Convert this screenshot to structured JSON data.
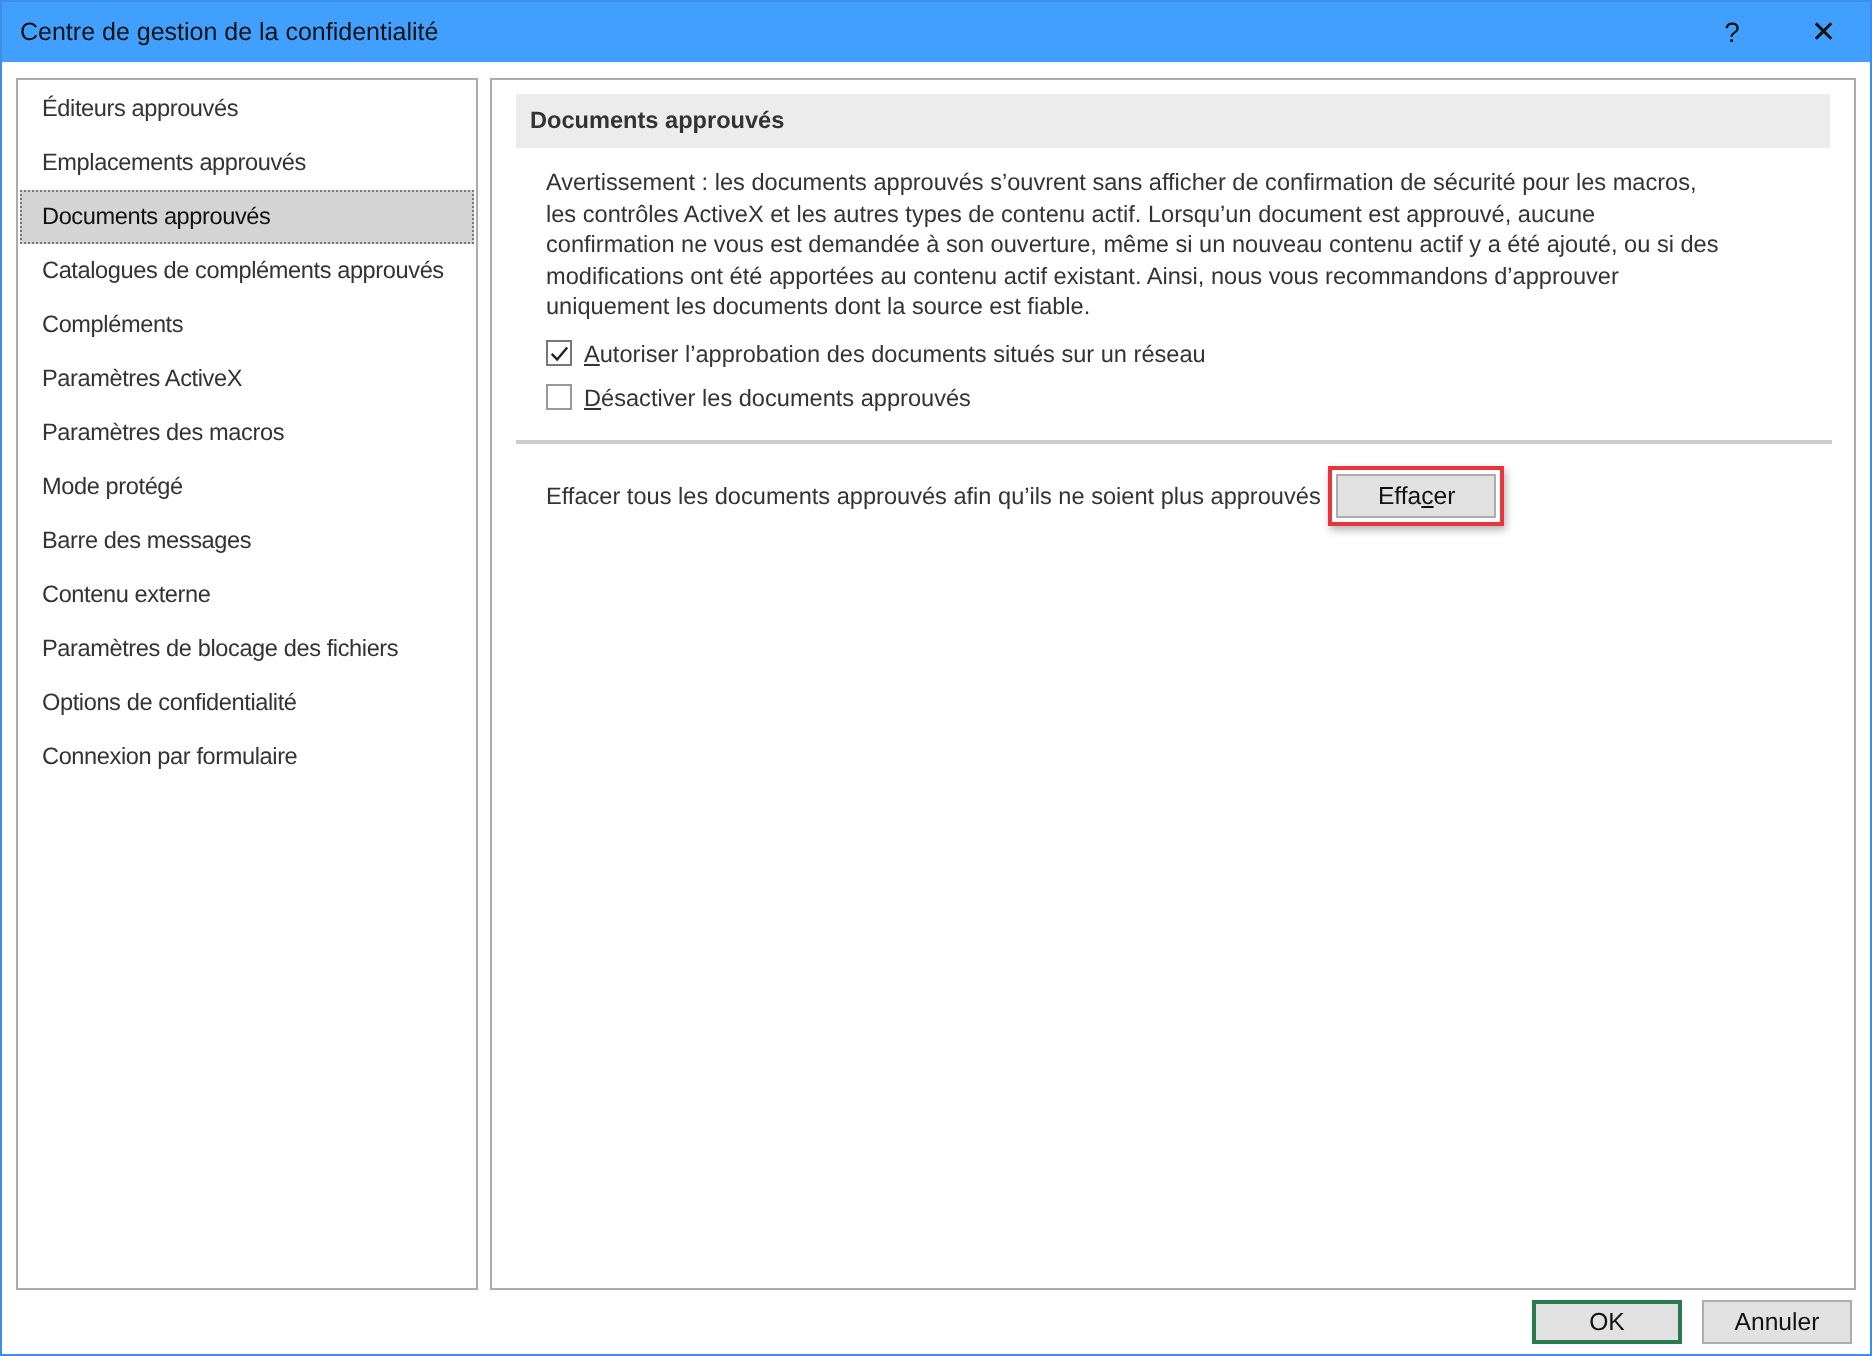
{
  "window": {
    "title": "Centre de gestion de la confidentialité",
    "help": "?",
    "close": "✕"
  },
  "sidebar": {
    "items": [
      {
        "label": "Éditeurs approuvés",
        "selected": false
      },
      {
        "label": "Emplacements approuvés",
        "selected": false
      },
      {
        "label": "Documents approuvés",
        "selected": true
      },
      {
        "label": "Catalogues de compléments approuvés",
        "selected": false
      },
      {
        "label": "Compléments",
        "selected": false
      },
      {
        "label": "Paramètres ActiveX",
        "selected": false
      },
      {
        "label": "Paramètres des macros",
        "selected": false
      },
      {
        "label": "Mode protégé",
        "selected": false
      },
      {
        "label": "Barre des messages",
        "selected": false
      },
      {
        "label": "Contenu externe",
        "selected": false
      },
      {
        "label": "Paramètres de blocage des fichiers",
        "selected": false
      },
      {
        "label": "Options de confidentialité",
        "selected": false
      },
      {
        "label": "Connexion par formulaire",
        "selected": false
      }
    ]
  },
  "section": {
    "heading": "Documents approuvés",
    "warning": "Avertissement : les documents approuvés s’ouvrent sans afficher de confirmation de sécurité pour les macros, les contrôles ActiveX et les autres types de contenu actif. Lorsqu’un document est approuvé, aucune confirmation ne vous est demandée à son ouverture, même si un nouveau contenu actif y a été ajouté, ou si des modifications ont été apportées au contenu actif existant. Ainsi, nous vous recommandons d’approuver uniquement les documents dont la source est fiable.",
    "options": [
      {
        "mnemonic": "A",
        "label_after": "utoriser l’approbation des documents situés sur un réseau",
        "checked": true
      },
      {
        "mnemonic": "D",
        "label_after": "ésactiver les documents approuvés",
        "checked": false
      }
    ],
    "clear_text": "Effacer tous les documents approuvés afin qu’ils ne soient plus approuvés",
    "clear_button": {
      "label_before": "Effa",
      "mnemonic": "c",
      "label_after": "er",
      "highlighted": true
    }
  },
  "buttons": [
    {
      "label": "OK",
      "default": true
    },
    {
      "label": "Annuler",
      "default": false
    }
  ]
}
